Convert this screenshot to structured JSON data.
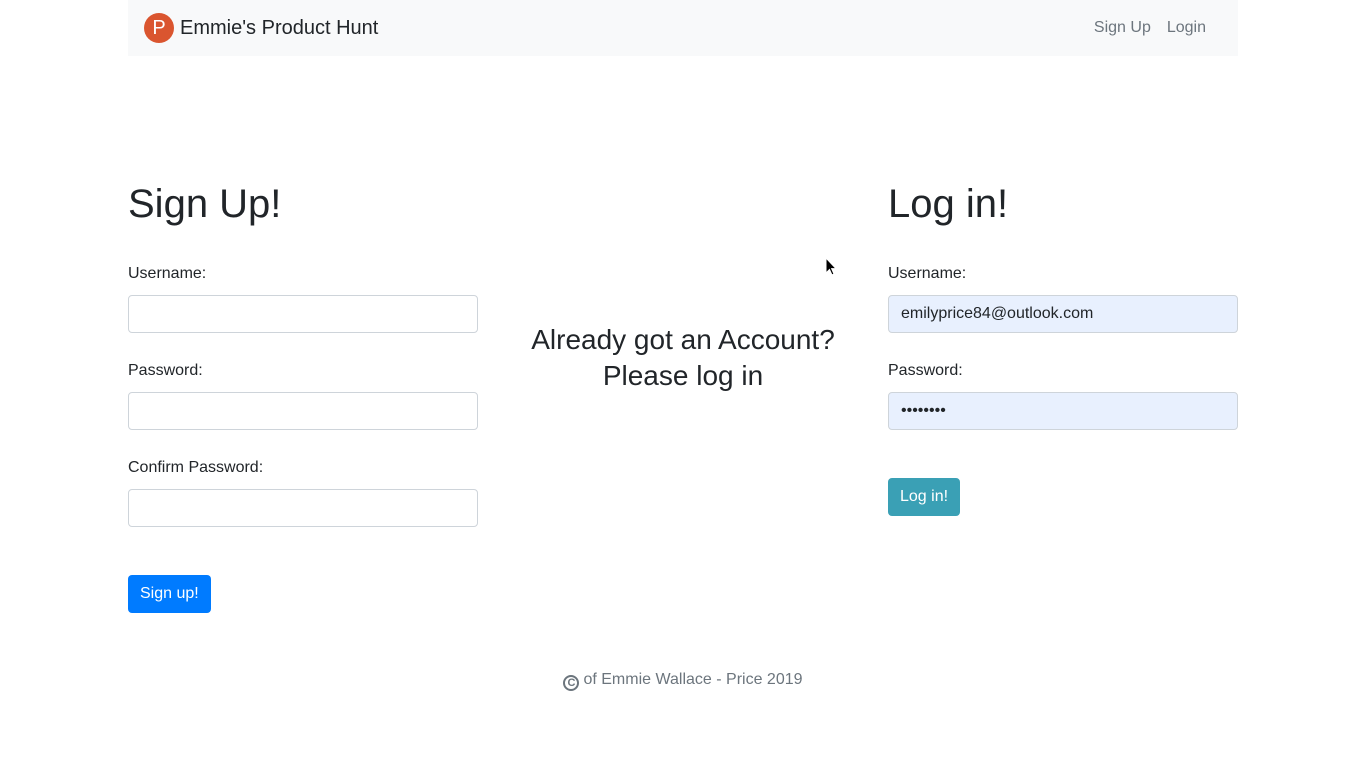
{
  "navbar": {
    "brand_logo_letter": "P",
    "brand_title": "Emmie's Product Hunt",
    "links": [
      "Sign Up",
      "Login"
    ],
    "brand_color": "#da552f"
  },
  "signup": {
    "heading": "Sign Up!",
    "username_label": "Username:",
    "username_value": "",
    "password_label": "Password:",
    "password_value": "",
    "confirm_label": "Confirm Password:",
    "confirm_value": "",
    "submit_label": "Sign up!",
    "submit_color": "#007bff"
  },
  "middle": {
    "line1": "Already got an Account?",
    "line2": "Please log in"
  },
  "login": {
    "heading": "Log in!",
    "username_label": "Username:",
    "username_value": "emilyprice84@outlook.com",
    "password_label": "Password:",
    "password_value": "••••••••",
    "submit_label": "Log in!",
    "submit_color": "#3aa0b5"
  },
  "footer": {
    "copyright_icon": "copyright-icon",
    "text": "of Emmie Wallace - Price 2019"
  }
}
